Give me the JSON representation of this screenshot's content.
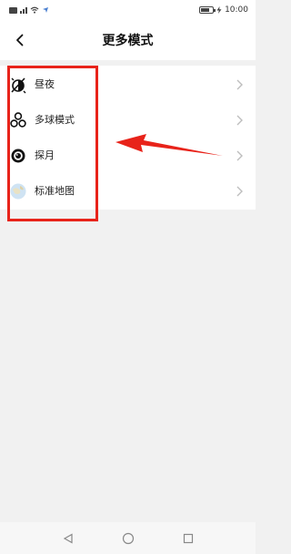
{
  "statusbar": {
    "time": "10:00",
    "battery": "94"
  },
  "header": {
    "title": "更多模式"
  },
  "modes": [
    {
      "label": "昼夜",
      "icon": "day-night-icon"
    },
    {
      "label": "多球模式",
      "icon": "multi-ball-icon"
    },
    {
      "label": "探月",
      "icon": "moon-explore-icon"
    },
    {
      "label": "标准地图",
      "icon": "standard-map-icon"
    }
  ],
  "annotation": {
    "box_color": "#e8231a",
    "arrow_color": "#e8231a"
  }
}
